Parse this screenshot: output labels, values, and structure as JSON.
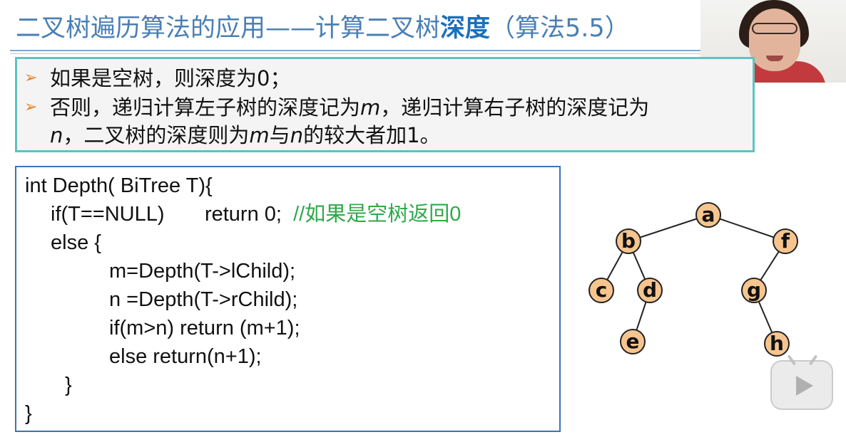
{
  "title": {
    "prefix": "二叉树遍历算法的应用——计算二叉树",
    "highlight": "深度",
    "suffix": "（算法5.5）"
  },
  "rules": {
    "bullet": "➢",
    "line1": "如果是空树，则深度为0；",
    "line2": "否则，递归计算左子树的深度记为",
    "var_m": "m",
    "line2_tail": "，递归计算右子树的深度记为",
    "var_n": "n",
    "line3_a": "，二叉树的深度则为",
    "line3_b": "与",
    "line3_c": "的较大者加1。"
  },
  "code": {
    "line1": "int Depth( BiTree T){",
    "line2_code": "if(T==NULL)       return 0;",
    "line2_comment": "//如果是空树返回0",
    "line3": "else {",
    "line4": "m=Depth(T->lChild);",
    "line5": "n =Depth(T->rChild);",
    "line6": "if(m>n) return (m+1);",
    "line7": "else return(n+1);",
    "line8": "}",
    "line9": "}"
  },
  "tree": {
    "nodes": [
      "a",
      "b",
      "f",
      "c",
      "d",
      "g",
      "e",
      "h"
    ],
    "node_fill": "#f6c58f",
    "node_stroke": "#222222",
    "edge_color": "#222222"
  },
  "colors": {
    "title": "#4a7fb5",
    "highlight": "#1f6fb8",
    "box_border": "#5cc4c1",
    "code_border": "#3c73b8",
    "comment": "#2ea94a",
    "bullet": "#e8822a"
  },
  "overlays": {
    "play_icon": "play-icon"
  }
}
